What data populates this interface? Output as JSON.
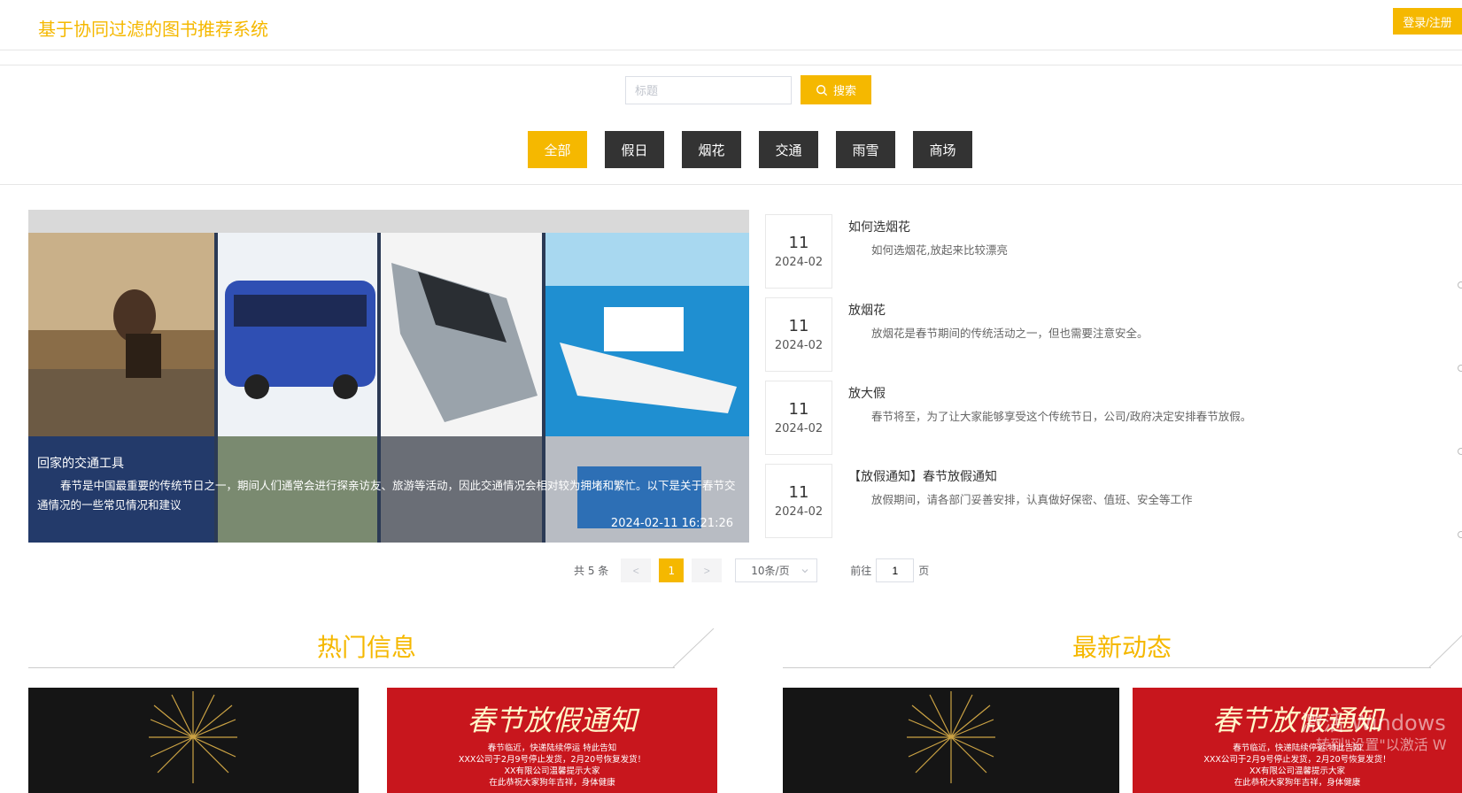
{
  "header": {
    "site_title": "基于协同过滤的图书推荐系统",
    "login_label": "登录/注册"
  },
  "search": {
    "placeholder": "标题",
    "button_label": "搜索"
  },
  "categories": [
    {
      "label": "全部",
      "active": true
    },
    {
      "label": "假日",
      "active": false
    },
    {
      "label": "烟花",
      "active": false
    },
    {
      "label": "交通",
      "active": false
    },
    {
      "label": "雨雪",
      "active": false
    },
    {
      "label": "商场",
      "active": false
    }
  ],
  "feature": {
    "title": "回家的交通工具",
    "description": "春节是中国最重要的传统节日之一，期间人们通常会进行探亲访友、旅游等活动，因此交通情况会相对较为拥堵和繁忙。以下是关于春节交通情况的一些常见情况和建议",
    "time": "2024-02-11 16:21:26"
  },
  "news": [
    {
      "day": "11",
      "ym": "2024-02",
      "title": "如何选烟花",
      "desc": "如何选烟花,放起来比较漂亮"
    },
    {
      "day": "11",
      "ym": "2024-02",
      "title": "放烟花",
      "desc": "放烟花是春节期间的传统活动之一，但也需要注意安全。"
    },
    {
      "day": "11",
      "ym": "2024-02",
      "title": "放大假",
      "desc": "春节将至，为了让大家能够享受这个传统节日，公司/政府决定安排春节放假。"
    },
    {
      "day": "11",
      "ym": "2024-02",
      "title": "【放假通知】春节放假通知",
      "desc": "放假期间，请各部门妥善安排，认真做好保密、值班、安全等工作"
    }
  ],
  "pagination": {
    "total": "共 5 条",
    "prev": "<",
    "current": "1",
    "next": ">",
    "page_size": "10条/页",
    "goto_label": "前往",
    "goto_value": "1",
    "page_suffix": "页"
  },
  "sections": {
    "hot": "热门信息",
    "latest": "最新动态"
  },
  "thumbs": {
    "red_title": "春节放假通知",
    "red_line1": "春节临近，快递陆续停运 特此告知",
    "red_line2": "XXX公司于2月9号停止发货，2月20号恢复发货！",
    "red_line3": "XX有限公司温馨提示大家",
    "red_line4": "在此恭祝大家狗年吉祥，身体健康"
  },
  "watermark": {
    "line1": "激活 Windows",
    "line2": "转到\"设置\"以激活 W"
  },
  "colors": {
    "accent": "#f5b800",
    "dark_button": "#333333"
  }
}
